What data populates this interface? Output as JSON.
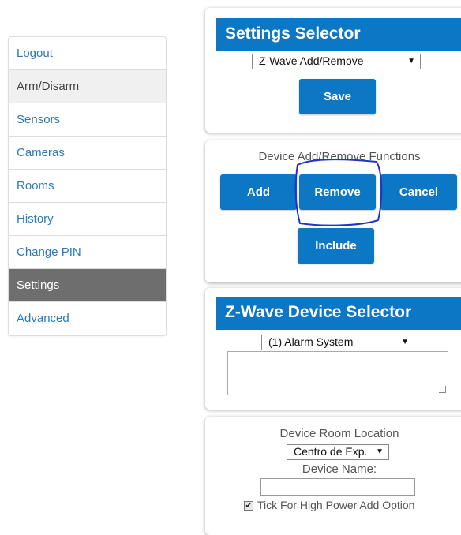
{
  "sidebar": {
    "items": [
      {
        "label": "Logout"
      },
      {
        "label": "Arm/Disarm"
      },
      {
        "label": "Sensors"
      },
      {
        "label": "Cameras"
      },
      {
        "label": "Rooms"
      },
      {
        "label": "History"
      },
      {
        "label": "Change PIN"
      },
      {
        "label": "Settings"
      },
      {
        "label": "Advanced"
      }
    ],
    "active": "Settings"
  },
  "settings_selector": {
    "title": "Settings Selector",
    "selected": "Z-Wave Add/Remove",
    "save_label": "Save"
  },
  "device_functions": {
    "heading": "Device Add/Remove Functions",
    "add_label": "Add",
    "remove_label": "Remove",
    "cancel_label": "Cancel",
    "include_label": "Include"
  },
  "device_selector": {
    "title": "Z-Wave Device Selector",
    "selected": "(1) Alarm System"
  },
  "device_details": {
    "room_label": "Device Room Location",
    "room_selected": "Centro de Exp.",
    "name_label": "Device Name:",
    "name_value": "",
    "high_power_label": "Tick For High Power Add Option",
    "high_power_checked": true
  },
  "colors": {
    "accent": "#0c77c4",
    "active_nav": "#6e6e6e",
    "link": "#2a7ab8",
    "annotation": "#2233cc"
  },
  "icons": [
    "dropdown-arrow-icon",
    "checkmark-icon",
    "resize-handle-icon"
  ]
}
